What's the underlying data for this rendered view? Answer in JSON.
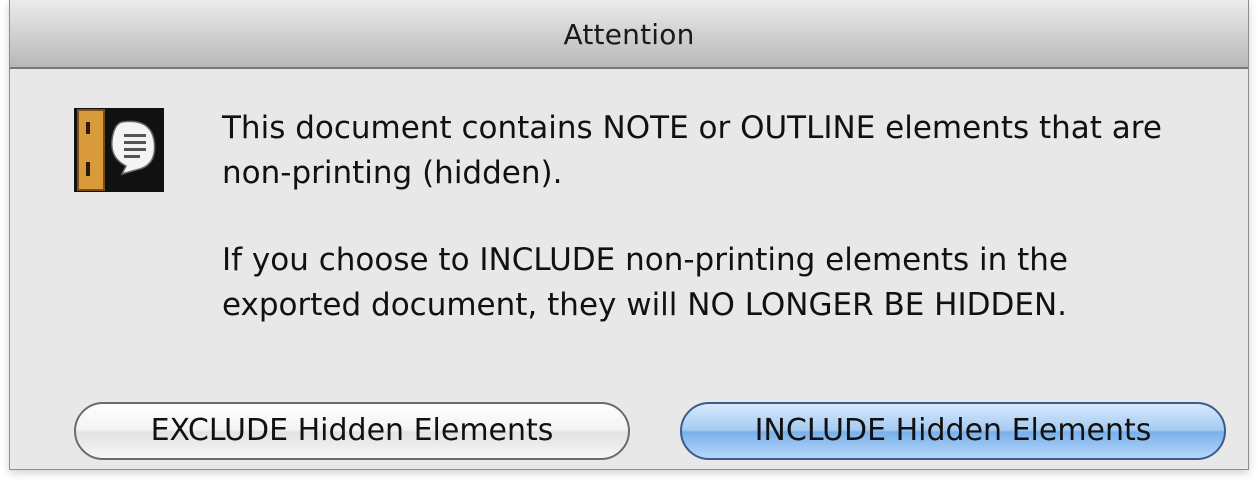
{
  "window": {
    "title": "Attention"
  },
  "dialog": {
    "icon": "app-note-icon",
    "message_line_1": "This document contains NOTE or OUTLINE elements that are non-printing (hidden).",
    "message_line_2": "If you choose to INCLUDE non-printing elements in the exported document, they will NO LONGER BE HIDDEN."
  },
  "buttons": {
    "exclude_label": "EXCLUDE Hidden Elements",
    "include_label": "INCLUDE Hidden Elements"
  },
  "colors": {
    "default_button": "#79b0ea",
    "dialog_background": "#e8e8e8"
  }
}
